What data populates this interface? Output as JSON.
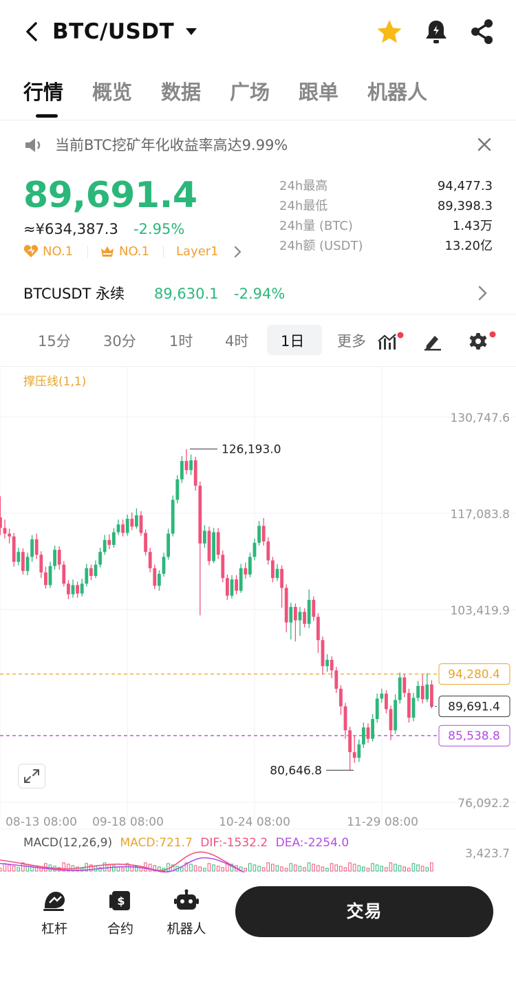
{
  "header": {
    "pair": "BTC/USDT"
  },
  "tabs": [
    "行情",
    "概览",
    "数据",
    "广场",
    "跟单",
    "机器人"
  ],
  "announcement": {
    "text": "当前BTC挖矿年化收益率高达9.99%"
  },
  "price": {
    "last": "89,691.4",
    "cny": "≈¥634,387.3",
    "change": "-2.95%",
    "ranks": [
      "NO.1",
      "NO.1",
      "Layer1"
    ]
  },
  "stats": [
    {
      "label": "24h最高",
      "value": "94,477.3"
    },
    {
      "label": "24h最低",
      "value": "89,398.3"
    },
    {
      "label": "24h量 (BTC)",
      "value": "1.43万"
    },
    {
      "label": "24h额 (USDT)",
      "value": "13.20亿"
    }
  ],
  "perpetual": {
    "name": "BTCUSDT 永续",
    "price": "89,630.1",
    "change": "-2.94%"
  },
  "intervals": [
    "15分",
    "30分",
    "1时",
    "4时",
    "1日",
    "更多"
  ],
  "active_interval": "1日",
  "chart_data": {
    "type": "candlestick",
    "indicator": "撑压线(1,1)",
    "y_ticks": [
      "130,747.6",
      "117,083.8",
      "103,419.9",
      "76,092.2"
    ],
    "x_ticks": [
      "08-13 08:00",
      "09-18 08:00",
      "10-24 08:00",
      "11-29 08:00"
    ],
    "high_marker": "126,193.0",
    "low_marker": "80,646.8",
    "resistance": "94,280.4",
    "current": "89,691.4",
    "support": "85,538.8",
    "macd_axis": "3,423.7",
    "macd": {
      "params": "MACD(12,26,9)",
      "macd": "MACD:721.7",
      "dif": "DIF:-1532.2",
      "dea": "DEA:-2254.0"
    },
    "candles": [
      [
        116500,
        115000,
        119500,
        114000
      ],
      [
        115000,
        114200,
        116200,
        113500
      ],
      [
        114200,
        113800,
        114900,
        112800
      ],
      [
        113800,
        110200,
        114300,
        109500
      ],
      [
        110200,
        111600,
        112200,
        109700
      ],
      [
        111600,
        108900,
        112100,
        108400
      ],
      [
        108900,
        110900,
        111500,
        108300
      ],
      [
        110900,
        113400,
        114000,
        110200
      ],
      [
        113400,
        111200,
        114200,
        110600
      ],
      [
        111200,
        108700,
        111700,
        107900
      ],
      [
        108700,
        106900,
        109500,
        106400
      ],
      [
        106900,
        109600,
        110200,
        106500
      ],
      [
        109600,
        111900,
        112500,
        109100
      ],
      [
        111900,
        109800,
        112400,
        109100
      ],
      [
        109800,
        107100,
        110300,
        106700
      ],
      [
        107100,
        105600,
        107600,
        104900
      ],
      [
        105600,
        106900,
        107700,
        105100
      ],
      [
        106900,
        105700,
        107400,
        105100
      ],
      [
        105700,
        107100,
        107800,
        105300
      ],
      [
        107100,
        109300,
        109900,
        106700
      ],
      [
        109300,
        108200,
        109800,
        107600
      ],
      [
        108200,
        109800,
        110400,
        107900
      ],
      [
        109800,
        111600,
        112200,
        109400
      ],
      [
        111600,
        113300,
        114000,
        111200
      ],
      [
        113300,
        112600,
        114100,
        112000
      ],
      [
        112600,
        114400,
        115000,
        112200
      ],
      [
        114400,
        115500,
        116200,
        114000
      ],
      [
        115500,
        114300,
        116200,
        113800
      ],
      [
        114300,
        116300,
        116900,
        113900
      ],
      [
        116300,
        115200,
        117200,
        114700
      ],
      [
        115200,
        116800,
        117800,
        114900
      ],
      [
        116800,
        114300,
        117400,
        113900
      ],
      [
        114300,
        111600,
        114800,
        111100
      ],
      [
        111600,
        109300,
        112200,
        108700
      ],
      [
        109300,
        106800,
        109800,
        106300
      ],
      [
        106800,
        108500,
        109000,
        106100
      ],
      [
        108500,
        110900,
        111500,
        108100
      ],
      [
        110900,
        114200,
        114900,
        110500
      ],
      [
        114200,
        119000,
        119600,
        113800
      ],
      [
        119000,
        121900,
        122500,
        118500
      ],
      [
        121900,
        124500,
        125200,
        121400
      ],
      [
        124500,
        123200,
        126193,
        122600
      ],
      [
        123200,
        124600,
        125400,
        122500
      ],
      [
        124600,
        121000,
        125100,
        120300
      ],
      [
        121000,
        112800,
        121600,
        102600
      ],
      [
        112800,
        114600,
        115400,
        112200
      ],
      [
        114600,
        110300,
        115200,
        109700
      ],
      [
        110300,
        114400,
        115000,
        110000
      ],
      [
        114400,
        111200,
        115000,
        110600
      ],
      [
        111200,
        107900,
        111800,
        107300
      ],
      [
        107900,
        105400,
        108400,
        104800
      ],
      [
        105400,
        107700,
        108300,
        105000
      ],
      [
        107700,
        106100,
        108300,
        105600
      ],
      [
        106100,
        109300,
        109900,
        105800
      ],
      [
        109300,
        108400,
        110100,
        107800
      ],
      [
        108400,
        110900,
        111500,
        108000
      ],
      [
        110900,
        112900,
        113500,
        110400
      ],
      [
        112900,
        115300,
        116000,
        112500
      ],
      [
        115300,
        113100,
        116400,
        112500
      ],
      [
        113100,
        110400,
        113700,
        109800
      ],
      [
        110400,
        107900,
        110900,
        107300
      ],
      [
        107900,
        109200,
        109900,
        107500
      ],
      [
        109200,
        106500,
        109700,
        103700
      ],
      [
        106500,
        101600,
        107000,
        100200
      ],
      [
        101600,
        103800,
        104400,
        99200
      ],
      [
        103800,
        101900,
        104300,
        98900
      ],
      [
        101900,
        103100,
        103800,
        99700
      ],
      [
        103100,
        101400,
        103600,
        100900
      ],
      [
        101400,
        104800,
        106300,
        100800
      ],
      [
        104800,
        102400,
        105300,
        101800
      ],
      [
        102400,
        99100,
        102900,
        97300
      ],
      [
        99100,
        95400,
        99600,
        94200
      ],
      [
        95400,
        96300,
        97100,
        94600
      ],
      [
        96300,
        94800,
        96800,
        93700
      ],
      [
        94800,
        92200,
        95300,
        91600
      ],
      [
        92200,
        89700,
        92700,
        88500
      ],
      [
        89700,
        86300,
        90200,
        85100
      ],
      [
        86300,
        83200,
        86800,
        80646.8
      ],
      [
        83200,
        82400,
        85600,
        81700
      ],
      [
        82400,
        84300,
        85000,
        81800
      ],
      [
        84300,
        86700,
        87400,
        83800
      ],
      [
        86700,
        85100,
        87300,
        84500
      ],
      [
        85100,
        87900,
        88600,
        84700
      ],
      [
        87900,
        90800,
        91500,
        87400
      ],
      [
        90800,
        91500,
        92200,
        90200
      ],
      [
        91500,
        89300,
        92000,
        88700
      ],
      [
        89300,
        86300,
        89800,
        84900
      ],
      [
        86300,
        90600,
        91400,
        85800
      ],
      [
        90600,
        93800,
        94500,
        90100
      ],
      [
        93800,
        91600,
        94300,
        91000
      ],
      [
        91600,
        88100,
        92200,
        87400
      ],
      [
        88100,
        90900,
        91600,
        87600
      ],
      [
        90900,
        92600,
        93300,
        90400
      ],
      [
        92600,
        90700,
        94200,
        90100
      ],
      [
        90700,
        92800,
        94400,
        90300
      ],
      [
        92800,
        89691.4,
        93400,
        89398.3
      ]
    ]
  },
  "bottom_nav": [
    "杠杆",
    "合约",
    "机器人"
  ],
  "trade_label": "交易",
  "colors": {
    "up": "#2cb77a",
    "down": "#f0527b",
    "accent": "#f0a030",
    "support": "#b44be1",
    "resistance": "#e7a42b"
  }
}
